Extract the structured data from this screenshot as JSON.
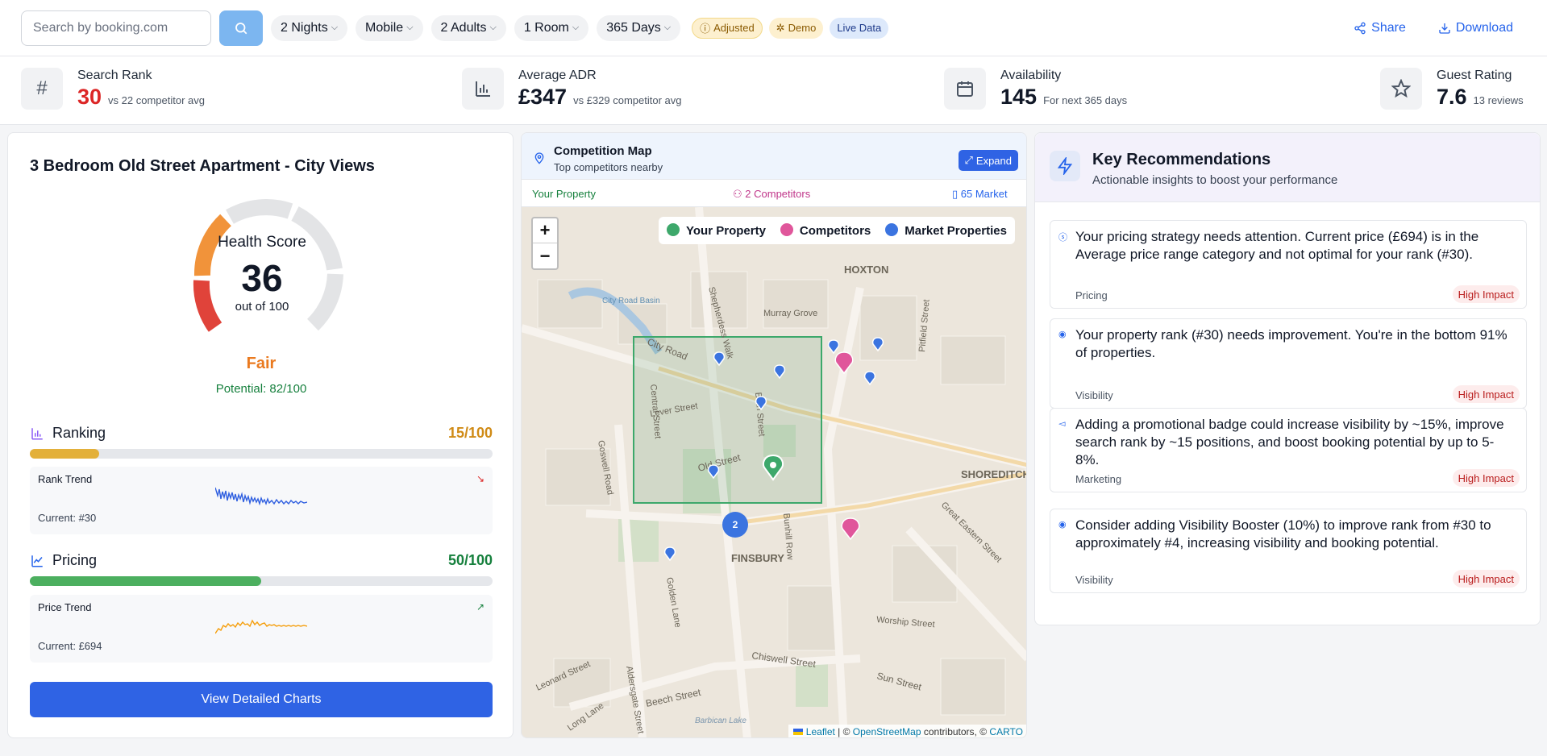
{
  "toolbar": {
    "search_placeholder": "Search by booking.com",
    "filters": [
      {
        "label": "2 Nights"
      },
      {
        "label": "Mobile"
      },
      {
        "label": "2 Adults"
      },
      {
        "label": "1 Room"
      },
      {
        "label": "365 Days"
      }
    ],
    "badges": {
      "adjusted": "Adjusted",
      "demo": "Demo",
      "live": "Live Data"
    },
    "share_label": "Share",
    "download_label": "Download"
  },
  "stats": {
    "search_rank": {
      "label": "Search Rank",
      "value": "30",
      "sub": "vs 22 competitor avg"
    },
    "adr": {
      "label": "Average ADR",
      "value": "£347",
      "sub": "vs £329 competitor avg"
    },
    "availability": {
      "label": "Availability",
      "value": "145",
      "sub": "For next 365 days"
    },
    "guest_rating": {
      "label": "Guest Rating",
      "value": "7.6",
      "sub": "13 reviews"
    }
  },
  "property": {
    "title": "3 Bedroom Old Street Apartment - City Views",
    "health": {
      "title": "Health Score",
      "score": 36,
      "max": 100,
      "sub": "out of 100",
      "status": "Fair",
      "potential": "Potential: 82/100"
    },
    "ranking": {
      "name": "Ranking",
      "score_text": "15/100",
      "score": 15,
      "trend_label": "Rank Trend",
      "current": "Current: #30"
    },
    "pricing": {
      "name": "Pricing",
      "score_text": "50/100",
      "score": 50,
      "trend_label": "Price Trend",
      "current": "Current: £694"
    },
    "view_button": "View Detailed Charts"
  },
  "map": {
    "title": "Competition Map",
    "subtitle": "Top competitors nearby",
    "expand": "Expand",
    "your_property": "Your Property",
    "competitors": "2 Competitors",
    "market": "65 Market",
    "legend": [
      "Your Property",
      "Competitors",
      "Market Properties"
    ],
    "cluster_count": "2",
    "zoom_in": "+",
    "zoom_out": "−",
    "attribution": {
      "leaflet": "Leaflet",
      "osm": "OpenStreetMap",
      "mid": "contributors, ©",
      "carto": "CARTO"
    },
    "place_labels": [
      "HOXTON",
      "SHOREDITCH",
      "FINSBURY",
      "City Road Basin",
      "Murray Grove",
      "City Road",
      "Shepherdess Walk",
      "Old Street",
      "Bath Street",
      "Pitfield Street",
      "Central Street",
      "Lever Street",
      "Goswell Road",
      "Bunhill Row",
      "Chiswell Street",
      "Worship Street",
      "Sun Street",
      "Beech Street",
      "Aldersgate Street",
      "Golden Lane",
      "Great Eastern Street",
      "Barbican Lake",
      "Long Lane",
      "Leonard Street"
    ]
  },
  "recommendations": {
    "title": "Key Recommendations",
    "subtitle": "Actionable insights to boost your performance",
    "items": [
      {
        "text": "Your pricing strategy needs attention. Current price (£694) is in the Average price range category and not optimal for your rank (#30).",
        "category": "Pricing",
        "impact": "High Impact"
      },
      {
        "text": "Your property rank (#30) needs improvement. You're in the bottom 91% of properties.",
        "category": "Visibility",
        "impact": "High Impact"
      },
      {
        "text": "Adding a promotional badge could increase visibility by ~15%, improve search rank by ~15 positions, and boost booking potential by up to 5-8%.",
        "category": "Marketing",
        "impact": "High Impact"
      },
      {
        "text": "Consider adding Visibility Booster (10%) to improve rank from #30 to approximately #4, increasing visibility and booking potential.",
        "category": "Visibility",
        "impact": "High Impact"
      }
    ]
  },
  "colors": {
    "primary": "#2f63e4",
    "rank_red": "#dc2626",
    "fair_orange": "#ea7a1f",
    "ranking_bar": "#e3b03a",
    "pricing_bar": "#4caf5f",
    "your_property": "#3da86b",
    "competitor": "#e0569b",
    "market": "#3b74e0"
  }
}
